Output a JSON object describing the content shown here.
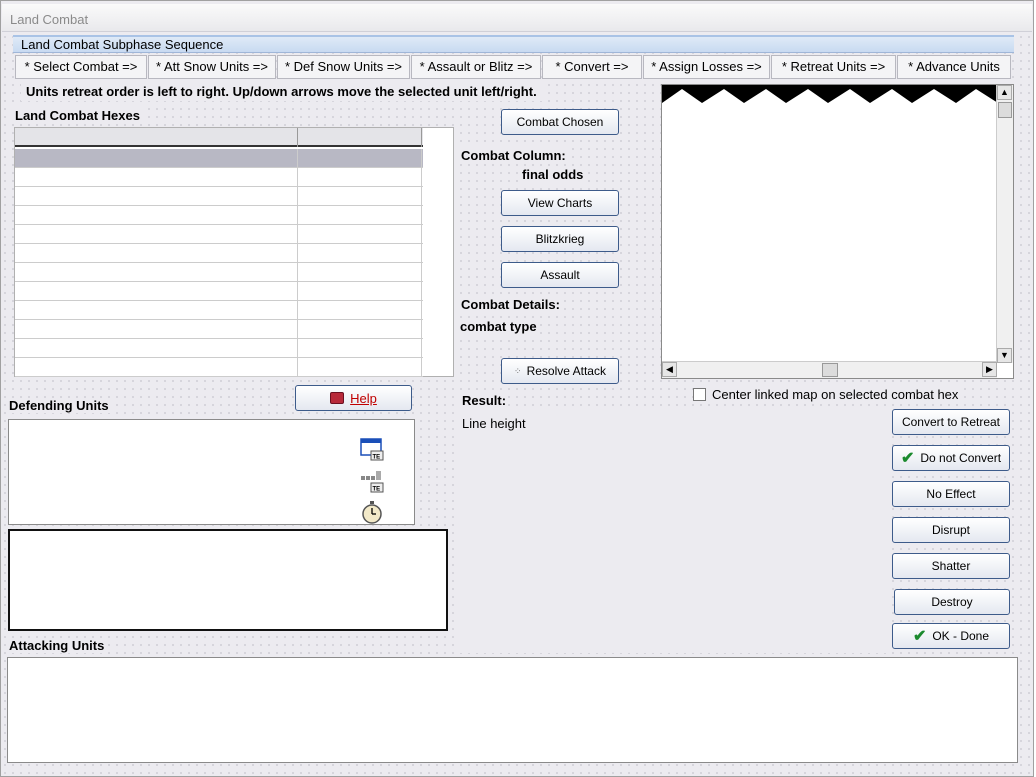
{
  "window": {
    "title": "Land Combat"
  },
  "sequence": {
    "title": "Land Combat Subphase Sequence",
    "steps": [
      "* Select Combat =>",
      "* Att Snow Units =>",
      "* Def Snow Units =>",
      "* Assault or Blitz =>",
      "* Convert =>",
      "* Assign Losses =>",
      "* Retreat Units =>",
      "* Advance Units"
    ]
  },
  "instructions": "Units retreat order is left to right.  Up/down arrows move the selected unit left/right.",
  "hexes": {
    "title": "Land Combat Hexes",
    "rows": 12
  },
  "combat": {
    "chosen_button": "Combat Chosen",
    "column_label": "Combat Column:",
    "odds_value": "final odds",
    "view_charts_button": "View Charts",
    "blitzkrieg_button": "Blitzkrieg",
    "assault_button": "Assault",
    "details_label": "Combat Details:",
    "type_value": "combat type",
    "resolve_button": "Resolve Attack",
    "result_label": "Result:",
    "result_value": "Line height"
  },
  "map": {
    "center_checkbox_label": "Center linked map on selected combat hex",
    "center_checked": false
  },
  "defending": {
    "title": "Defending Units",
    "help_button": "Help"
  },
  "attacking": {
    "title": "Attacking Units"
  },
  "results_buttons": {
    "convert_to_retreat": "Convert to Retreat",
    "do_not_convert": "Do not Convert",
    "no_effect": "No Effect",
    "disrupt": "Disrupt",
    "shatter": "Shatter",
    "destroy": "Destroy",
    "ok_done": "OK - Done"
  },
  "icons": {
    "window1": "window-te-icon",
    "window2": "grid-te-icon",
    "timer": "stopwatch-icon",
    "help": "book-icon",
    "check": "check-icon",
    "resolve": "dots-icon"
  }
}
